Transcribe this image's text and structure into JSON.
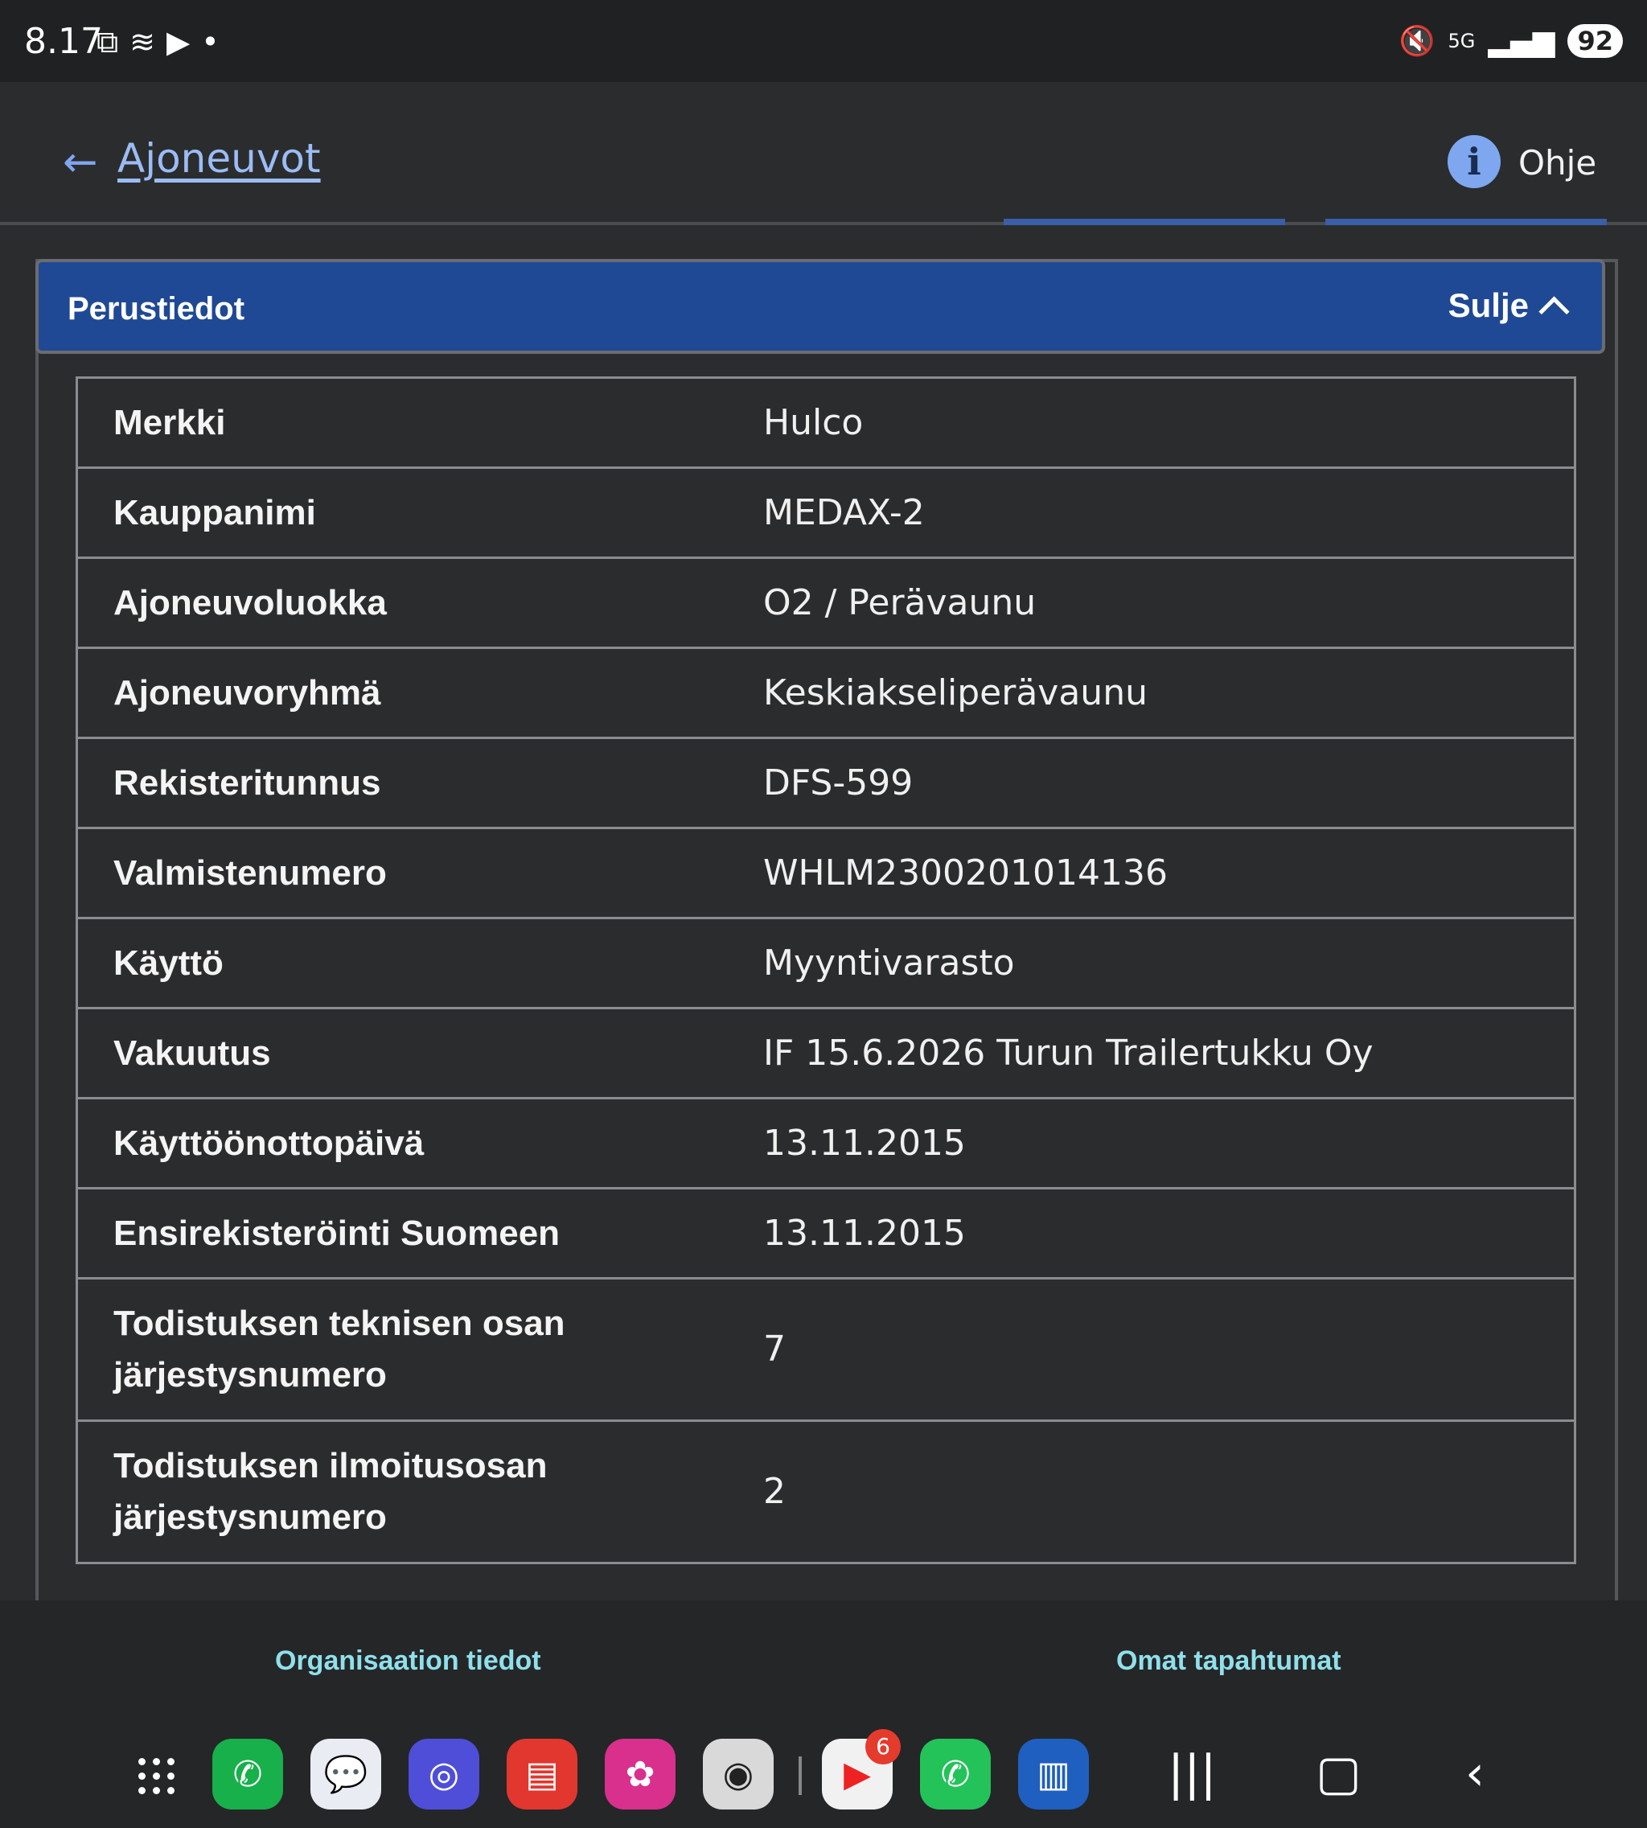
{
  "status_bar": {
    "time": "8.17",
    "battery": "92",
    "network": "5G"
  },
  "header": {
    "back_label": "Ajoneuvot",
    "help_label": "Ohje"
  },
  "panel": {
    "title": "Perustiedot",
    "close_label": "Sulje",
    "rows": [
      {
        "key": "Merkki",
        "value": "Hulco"
      },
      {
        "key": "Kauppanimi",
        "value": "MEDAX-2"
      },
      {
        "key": "Ajoneuvoluokka",
        "value": "O2 / Perävaunu"
      },
      {
        "key": "Ajoneuvoryhmä",
        "value": "Keskiakseliperävaunu"
      },
      {
        "key": "Rekisteritunnus",
        "value": "DFS-599"
      },
      {
        "key": "Valmistenumero",
        "value": "WHLM2300201014136"
      },
      {
        "key": "Käyttö",
        "value": "Myyntivarasto"
      },
      {
        "key": "Vakuutus",
        "value": "IF 15.6.2026 Turun Trailertukku Oy"
      },
      {
        "key": "Käyttöönottopäivä",
        "value": "13.11.2015"
      },
      {
        "key": "Ensirekisteröinti Suomeen",
        "value": "13.11.2015"
      },
      {
        "key": "Todistuksen teknisen osan järjestysnumero",
        "value": "7"
      },
      {
        "key": "Todistuksen ilmoitusosan järjestysnumero",
        "value": "2"
      }
    ]
  },
  "bottom_nav": {
    "left": "Organisaation tiedot",
    "right": "Omat tapahtumat"
  },
  "dock": {
    "youtube_badge": "6"
  },
  "colors": {
    "panel_header": "#1f4994",
    "link": "#9bbcf5",
    "bottom_link": "#8fe0ea"
  }
}
